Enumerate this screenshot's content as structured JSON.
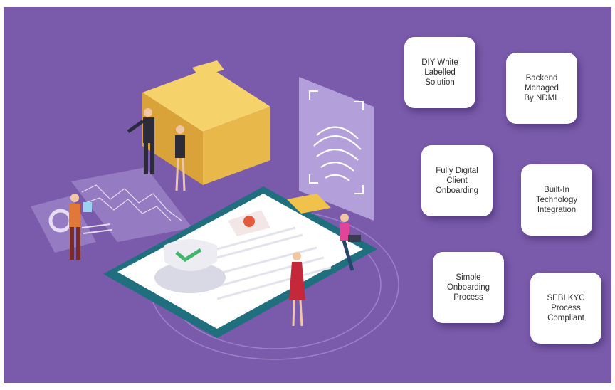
{
  "features": [
    {
      "label": "DIY White\nLabelled\nSolution"
    },
    {
      "label": "Backend\nManaged\nBy NDML"
    },
    {
      "label": "Fully Digital\nClient\nOnboarding"
    },
    {
      "label": "Built-In\nTechnology\nIntegration"
    },
    {
      "label": "Simple\nOnboarding\nProcess"
    },
    {
      "label": "SEBI KYC\nProcess\nCompliant"
    }
  ],
  "colors": {
    "background": "#7a5bab",
    "clipboard": "#1f6f7e",
    "folder": "#f0c24b",
    "check": "#3fb56a"
  },
  "icons": [
    "folder-icon",
    "fingerprint-icon",
    "clipboard-icon",
    "checkmark-shield-icon",
    "profile-photo-icon"
  ]
}
